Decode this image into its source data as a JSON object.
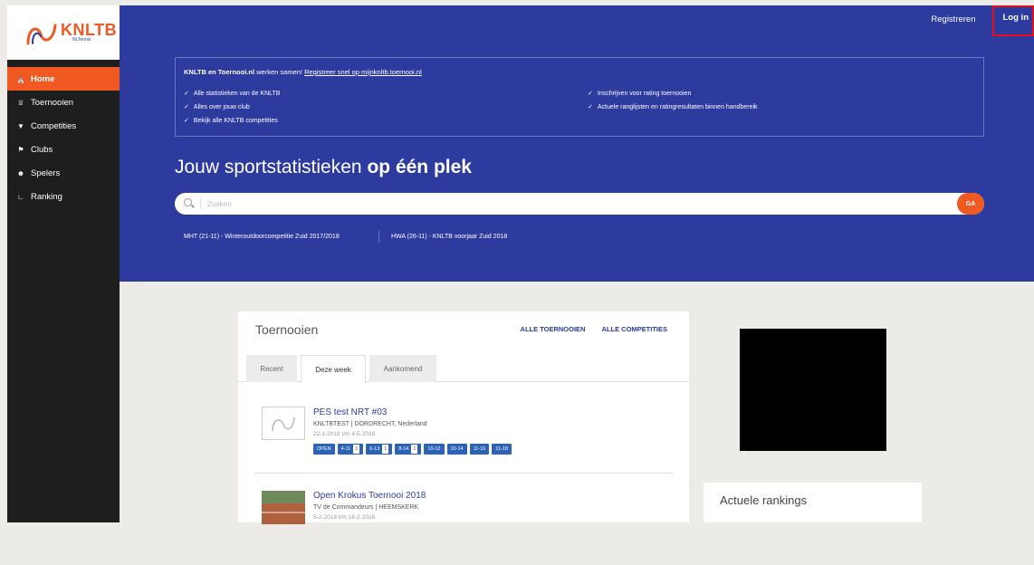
{
  "brand": {
    "name": "KNLTB",
    "subtitle": "NLTennis",
    "accent": "#f05a22",
    "primary": "#2d3a9e"
  },
  "header": {
    "register_label": "Registreren",
    "login_label": "Log in"
  },
  "nav": {
    "items": [
      {
        "label": "Home",
        "icon": "home-icon",
        "active": true
      },
      {
        "label": "Toernooien",
        "icon": "trophy-icon",
        "active": false
      },
      {
        "label": "Competities",
        "icon": "cup-icon",
        "active": false
      },
      {
        "label": "Clubs",
        "icon": "flag-icon",
        "active": false
      },
      {
        "label": "Spelers",
        "icon": "players-icon",
        "active": false
      },
      {
        "label": "Ranking",
        "icon": "chart-icon",
        "active": false
      }
    ]
  },
  "info": {
    "head_bold": "KNLTB en Toernooi.nl",
    "head_text": "werken samen!",
    "head_link": "Registreer snel op mijnknltb.toernooi.nl",
    "left": [
      "Alle statistieken van de KNLTB",
      "Alles over jouw club",
      "Bekijk alle KNLTB competities"
    ],
    "right": [
      "Inschrijven voor rating toernooien",
      "Actuele ranglijsten en ratingresultaten binnen handbereik"
    ]
  },
  "hero": {
    "title_plain": "Jouw sportstatistieken",
    "title_bold": "op één plek"
  },
  "search": {
    "placeholder": "Zoeken",
    "go_label": "GA"
  },
  "recent": [
    "MHT (21-11) - Winteroutdoorcompetitie Zuid 2017/2018",
    "HWA (26-11) - KNLTB voorjaar Zuid 2018"
  ],
  "tournaments": {
    "title": "Toernooien",
    "all_tournaments": "ALLE TOERNOOIEN",
    "all_competitions": "ALLE COMPETITIES",
    "tabs": [
      {
        "label": "Recent",
        "active": false
      },
      {
        "label": "Deze week",
        "active": true
      },
      {
        "label": "Aankomend",
        "active": false
      }
    ],
    "items": [
      {
        "name": "PES test NRT #03",
        "meta": "KNLTBTEST | DORDRECHT, Nederland",
        "date": "22-1-2018 t/m 4-5-2018",
        "badges": [
          {
            "label": "OPEN",
            "count": ""
          },
          {
            "label": "4-11",
            "count": "1"
          },
          {
            "label": "6-13",
            "count": "1"
          },
          {
            "label": "8-14",
            "count": "1"
          },
          {
            "label": "10-12",
            "count": ""
          },
          {
            "label": "10-14",
            "count": ""
          },
          {
            "label": "11-16",
            "count": ""
          },
          {
            "label": "11-18",
            "count": ""
          }
        ]
      },
      {
        "name": "Open Krokus Toernooi 2018",
        "meta": "TV de Commandeurs | HEEMSKERK",
        "date": "5-2-2018 t/m 18-2-2018",
        "badges": []
      }
    ]
  },
  "rankings": {
    "title": "Actuele rankings"
  }
}
